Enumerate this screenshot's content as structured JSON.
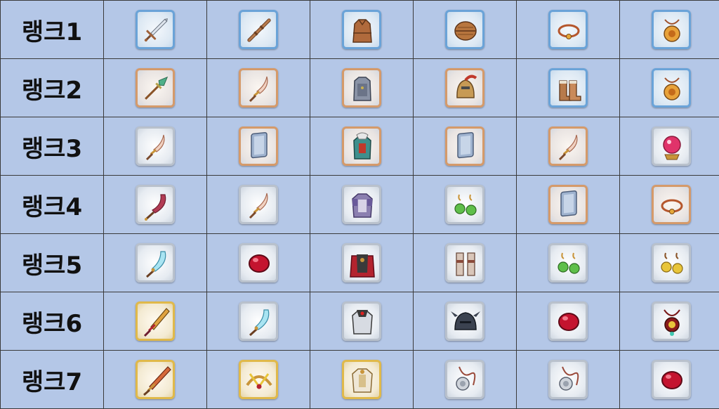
{
  "colors": {
    "background": "#b4c7e7",
    "grid_line": "#3a3a3a"
  },
  "rows": [
    {
      "rank_label": "랭크1",
      "items": [
        {
          "icon": "sword",
          "frame": "blue"
        },
        {
          "icon": "staff",
          "frame": "blue"
        },
        {
          "icon": "leather-armor",
          "frame": "blue"
        },
        {
          "icon": "helmet",
          "frame": "blue"
        },
        {
          "icon": "bracelet",
          "frame": "blue"
        },
        {
          "icon": "amulet",
          "frame": "blue"
        }
      ]
    },
    {
      "rank_label": "랭크2",
      "items": [
        {
          "icon": "spear",
          "frame": "bronze"
        },
        {
          "icon": "curved-sword",
          "frame": "bronze"
        },
        {
          "icon": "chainmail",
          "frame": "bronze"
        },
        {
          "icon": "crested-helmet",
          "frame": "bronze"
        },
        {
          "icon": "boots",
          "frame": "blue"
        },
        {
          "icon": "amulet",
          "frame": "blue"
        }
      ]
    },
    {
      "rank_label": "랭크3",
      "items": [
        {
          "icon": "curved-sword",
          "frame": "silver"
        },
        {
          "icon": "shield",
          "frame": "bronze"
        },
        {
          "icon": "plate-armor",
          "frame": "bronze"
        },
        {
          "icon": "shield",
          "frame": "bronze"
        },
        {
          "icon": "curved-sword",
          "frame": "bronze"
        },
        {
          "icon": "crystal-orb",
          "frame": "silver"
        }
      ]
    },
    {
      "rank_label": "랭크4",
      "items": [
        {
          "icon": "scimitar",
          "frame": "silver"
        },
        {
          "icon": "curved-sword",
          "frame": "silver"
        },
        {
          "icon": "heavy-armor",
          "frame": "silver"
        },
        {
          "icon": "earrings",
          "frame": "silver"
        },
        {
          "icon": "shield",
          "frame": "bronze"
        },
        {
          "icon": "bracelet",
          "frame": "bronze"
        }
      ]
    },
    {
      "rank_label": "랭크5",
      "items": [
        {
          "icon": "ice-blade",
          "frame": "silver"
        },
        {
          "icon": "gem",
          "frame": "silver"
        },
        {
          "icon": "caped-armor",
          "frame": "silver"
        },
        {
          "icon": "greaves",
          "frame": "silver"
        },
        {
          "icon": "earrings",
          "frame": "silver"
        },
        {
          "icon": "earrings-gold",
          "frame": "silver"
        }
      ]
    },
    {
      "rank_label": "랭크6",
      "items": [
        {
          "icon": "ornate-sword",
          "frame": "gold"
        },
        {
          "icon": "ice-blade",
          "frame": "silver"
        },
        {
          "icon": "dark-armor",
          "frame": "silver"
        },
        {
          "icon": "dark-helmet",
          "frame": "silver"
        },
        {
          "icon": "gem",
          "frame": "silver"
        },
        {
          "icon": "pendant",
          "frame": "silver"
        }
      ]
    },
    {
      "rank_label": "랭크7",
      "items": [
        {
          "icon": "great-sword",
          "frame": "gold"
        },
        {
          "icon": "tiara",
          "frame": "gold"
        },
        {
          "icon": "holy-armor",
          "frame": "gold"
        },
        {
          "icon": "lion-pendant",
          "frame": "silver"
        },
        {
          "icon": "lion-pendant",
          "frame": "silver"
        },
        {
          "icon": "gem",
          "frame": "silver"
        }
      ]
    }
  ]
}
